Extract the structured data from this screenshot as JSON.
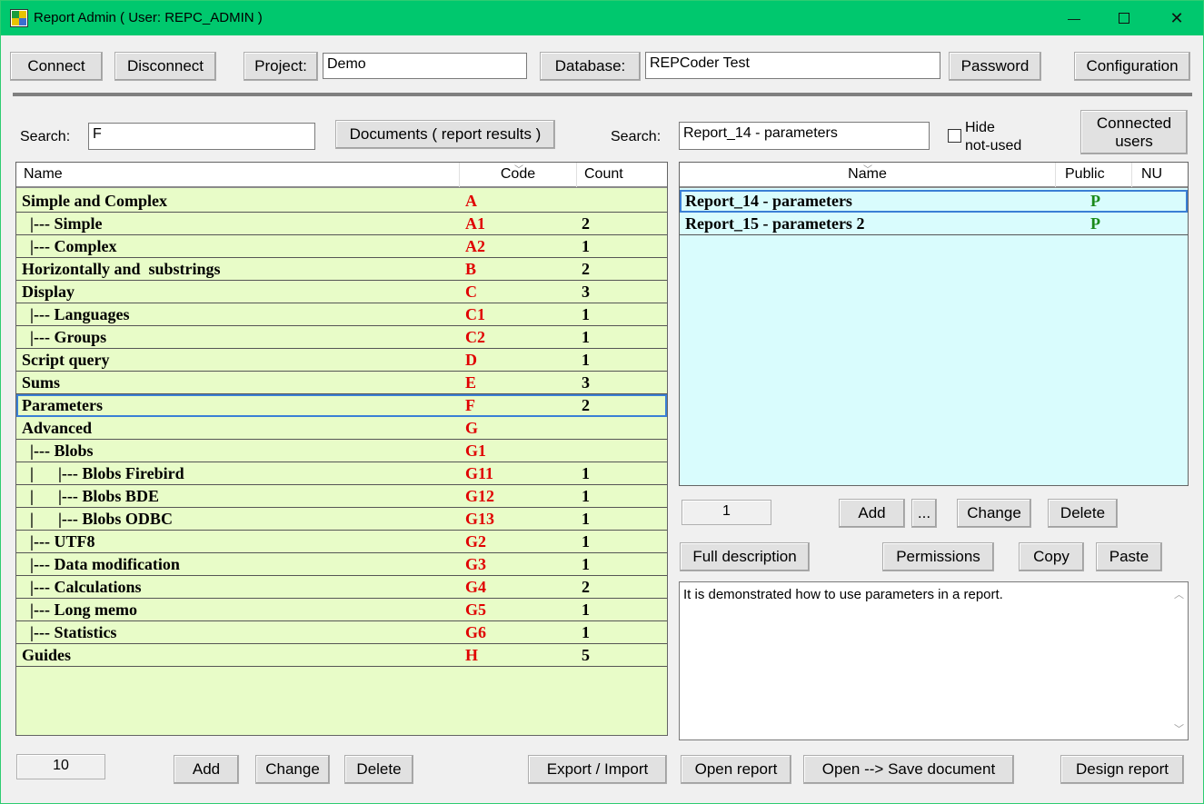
{
  "window": {
    "title": "Report Admin  ( User:  REPC_ADMIN )",
    "minimize": "—",
    "close": "✕"
  },
  "toolbar": {
    "connect": "Connect",
    "disconnect": "Disconnect",
    "project_label": "Project:",
    "project_value": "Demo",
    "database_label": "Database:",
    "database_value": "REPCoder Test",
    "password": "Password",
    "configuration": "Configuration"
  },
  "left": {
    "search_label": "Search:",
    "search_value": "F",
    "documents_button": "Documents ( report results )",
    "columns": {
      "name": "Name",
      "code": "Code",
      "count": "Count"
    },
    "rows": [
      {
        "name": "Simple and Complex",
        "code": "A",
        "count": ""
      },
      {
        "name": "  |--- Simple",
        "code": "A1",
        "count": "2"
      },
      {
        "name": "  |--- Complex",
        "code": "A2",
        "count": "1"
      },
      {
        "name": "Horizontally and  substrings",
        "code": "B",
        "count": "2"
      },
      {
        "name": "Display",
        "code": "C",
        "count": "3"
      },
      {
        "name": "  |--- Languages",
        "code": "C1",
        "count": "1"
      },
      {
        "name": "  |--- Groups",
        "code": "C2",
        "count": "1"
      },
      {
        "name": "Script query",
        "code": "D",
        "count": "1"
      },
      {
        "name": "Sums",
        "code": "E",
        "count": "3"
      },
      {
        "name": "Parameters",
        "code": "F",
        "count": "2"
      },
      {
        "name": "Advanced",
        "code": "G",
        "count": ""
      },
      {
        "name": "  |--- Blobs",
        "code": "G1",
        "count": ""
      },
      {
        "name": "  |      |--- Blobs Firebird",
        "code": "G11",
        "count": "1"
      },
      {
        "name": "  |      |--- Blobs BDE",
        "code": "G12",
        "count": "1"
      },
      {
        "name": "  |      |--- Blobs ODBC",
        "code": "G13",
        "count": "1"
      },
      {
        "name": "  |--- UTF8",
        "code": "G2",
        "count": "1"
      },
      {
        "name": "  |--- Data modification",
        "code": "G3",
        "count": "1"
      },
      {
        "name": "  |--- Calculations",
        "code": "G4",
        "count": "2"
      },
      {
        "name": "  |--- Long memo",
        "code": "G5",
        "count": "1"
      },
      {
        "name": "  |--- Statistics",
        "code": "G6",
        "count": "1"
      },
      {
        "name": "Guides",
        "code": "H",
        "count": "5"
      }
    ],
    "selected_index": 9,
    "counter": "10",
    "add": "Add",
    "change": "Change",
    "delete": "Delete",
    "export_import": "Export / Import"
  },
  "right": {
    "search_label": "Search:",
    "search_value": "Report_14 - parameters",
    "hide_not_used": "Hide",
    "hide_not_used_2": "not-used",
    "connected_users": "Connected",
    "connected_users_2": "users",
    "columns": {
      "name": "Name",
      "public": "Public",
      "nu": "NU"
    },
    "rows": [
      {
        "name": "Report_14 - parameters",
        "public": "P",
        "nu": ""
      },
      {
        "name": "Report_15 - parameters 2",
        "public": "P",
        "nu": ""
      }
    ],
    "counter": "1",
    "add": "Add",
    "more": "...",
    "change": "Change",
    "delete": "Delete",
    "full_description": "Full description",
    "permissions": "Permissions",
    "copy": "Copy",
    "paste": "Paste",
    "description": "It is demonstrated how to use parameters in a report.",
    "open_report": "Open report",
    "open_save": "Open --> Save document",
    "design_report": "Design report"
  },
  "colors": {
    "titlebar": "#00c86e",
    "left_grid_bg": "#e8fcc8",
    "right_grid_bg": "#d9fcfd",
    "code_red": "#e00000",
    "public_green": "#1a8a1a"
  }
}
